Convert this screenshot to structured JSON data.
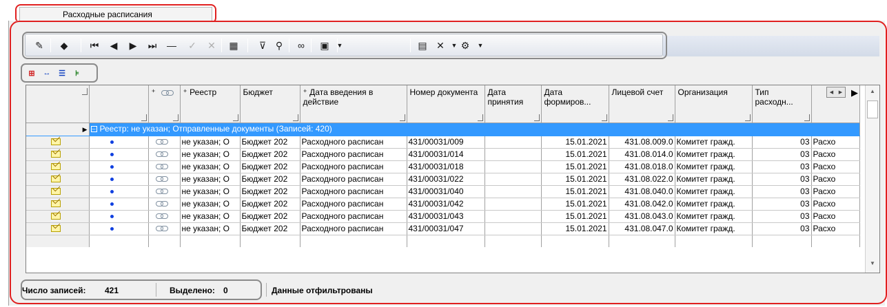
{
  "tab": {
    "label": "Расходные расписания"
  },
  "toolbar": {
    "buttons": [
      {
        "name": "edit",
        "icon": "edit-icon",
        "glyph": "✎",
        "disabled": false
      },
      {
        "name": "mark",
        "icon": "diamond-icon",
        "glyph": "◆",
        "disabled": false
      },
      {
        "name": "first",
        "icon": "first-record-icon",
        "glyph": "⏮",
        "disabled": false
      },
      {
        "name": "prev",
        "icon": "prev-record-icon",
        "glyph": "◀",
        "disabled": false
      },
      {
        "name": "next",
        "icon": "next-record-icon",
        "glyph": "▶",
        "disabled": false
      },
      {
        "name": "last",
        "icon": "last-record-icon",
        "glyph": "⏭",
        "disabled": false
      },
      {
        "name": "delete-record",
        "icon": "minus-icon",
        "glyph": "—",
        "disabled": false
      },
      {
        "name": "post",
        "icon": "check-icon",
        "glyph": "✓",
        "disabled": true
      },
      {
        "name": "cancel",
        "icon": "cancel-icon",
        "glyph": "✕",
        "disabled": true
      },
      {
        "name": "calculator",
        "icon": "calculator-icon",
        "glyph": "▦",
        "disabled": false
      },
      {
        "name": "filter",
        "icon": "filter-icon",
        "glyph": "⊽",
        "disabled": false
      },
      {
        "name": "find",
        "icon": "binoculars-icon",
        "glyph": "⚲",
        "disabled": false
      },
      {
        "name": "link",
        "icon": "link-icon",
        "glyph": "∞",
        "disabled": false
      },
      {
        "name": "export",
        "icon": "export-icon",
        "glyph": "▣",
        "disabled": false
      },
      {
        "name": "open-folder",
        "icon": "folder-icon",
        "glyph": "▤",
        "disabled": false
      },
      {
        "name": "close",
        "icon": "close-icon",
        "glyph": "✕",
        "disabled": false
      },
      {
        "name": "tools",
        "icon": "tools-icon",
        "glyph": "⚙",
        "disabled": false
      }
    ]
  },
  "small_toolbar": {
    "buttons": [
      {
        "icon": "insert-icon",
        "glyph": "⊞",
        "color": "#d02020"
      },
      {
        "icon": "swap-icon",
        "glyph": "↔",
        "color": "#1040c0"
      },
      {
        "icon": "checklist-icon",
        "glyph": "☰",
        "color": "#1040c0"
      },
      {
        "icon": "group-icon",
        "glyph": "⊧",
        "color": "#208020"
      }
    ]
  },
  "grid": {
    "columns": [
      {
        "key": "status",
        "label": ""
      },
      {
        "key": "mark",
        "label": ""
      },
      {
        "key": "link",
        "label": "⁺"
      },
      {
        "key": "registry",
        "label": "⁺ Реестр"
      },
      {
        "key": "budget",
        "label": "Бюджет"
      },
      {
        "key": "effective_date",
        "label": "⁺ Дата введения в действие"
      },
      {
        "key": "doc_number",
        "label": "Номер документа"
      },
      {
        "key": "accept_date",
        "label": "Дата принятия"
      },
      {
        "key": "form_date",
        "label": "Дата формиров..."
      },
      {
        "key": "account",
        "label": "Лицевой счет"
      },
      {
        "key": "org",
        "label": "Организация"
      },
      {
        "key": "exp_type",
        "label": "Тип расходн..."
      },
      {
        "key": "extra",
        "label": ""
      }
    ],
    "group_label": "Реестр: не указан; Отправленные документы (Записей: 420)",
    "rows": [
      {
        "registry": "не указан; О",
        "budget": "Бюджет 202",
        "doc_type": "Расходного расписан",
        "doc_number": "431/00031/009",
        "accept_date": "",
        "form_date": "15.01.2021",
        "account": "431.08.009.0",
        "org": "Комитет гражд.",
        "exp_type": "03",
        "extra": "Расхо"
      },
      {
        "registry": "не указан; О",
        "budget": "Бюджет 202",
        "doc_type": "Расходного расписан",
        "doc_number": "431/00031/014",
        "accept_date": "",
        "form_date": "15.01.2021",
        "account": "431.08.014.0",
        "org": "Комитет гражд.",
        "exp_type": "03",
        "extra": "Расхо"
      },
      {
        "registry": "не указан; О",
        "budget": "Бюджет 202",
        "doc_type": "Расходного расписан",
        "doc_number": "431/00031/018",
        "accept_date": "",
        "form_date": "15.01.2021",
        "account": "431.08.018.0",
        "org": "Комитет гражд.",
        "exp_type": "03",
        "extra": "Расхо"
      },
      {
        "registry": "не указан; О",
        "budget": "Бюджет 202",
        "doc_type": "Расходного расписан",
        "doc_number": "431/00031/022",
        "accept_date": "",
        "form_date": "15.01.2021",
        "account": "431.08.022.0",
        "org": "Комитет гражд.",
        "exp_type": "03",
        "extra": "Расхо"
      },
      {
        "registry": "не указан; О",
        "budget": "Бюджет 202",
        "doc_type": "Расходного расписан",
        "doc_number": "431/00031/040",
        "accept_date": "",
        "form_date": "15.01.2021",
        "account": "431.08.040.0",
        "org": "Комитет гражд.",
        "exp_type": "03",
        "extra": "Расхо"
      },
      {
        "registry": "не указан; О",
        "budget": "Бюджет 202",
        "doc_type": "Расходного расписан",
        "doc_number": "431/00031/042",
        "accept_date": "",
        "form_date": "15.01.2021",
        "account": "431.08.042.0",
        "org": "Комитет гражд.",
        "exp_type": "03",
        "extra": "Расхо"
      },
      {
        "registry": "не указан; О",
        "budget": "Бюджет 202",
        "doc_type": "Расходного расписан",
        "doc_number": "431/00031/043",
        "accept_date": "",
        "form_date": "15.01.2021",
        "account": "431.08.043.0",
        "org": "Комитет гражд.",
        "exp_type": "03",
        "extra": "Расхо"
      },
      {
        "registry": "не указан; О",
        "budget": "Бюджет 202",
        "doc_type": "Расходного расписан",
        "doc_number": "431/00031/047",
        "accept_date": "",
        "form_date": "15.01.2021",
        "account": "431.08.047.0",
        "org": "Комитет гражд.",
        "exp_type": "03",
        "extra": "Расхо"
      }
    ]
  },
  "status": {
    "count_label": "Число записей:",
    "count_value": "421",
    "selected_label": "Выделено:",
    "selected_value": "0",
    "filter_text": "Данные отфильтрованы"
  },
  "colors": {
    "highlight_red": "#e02020",
    "group_row": "#3399ff",
    "annotation_gray": "#8a8a8a"
  }
}
